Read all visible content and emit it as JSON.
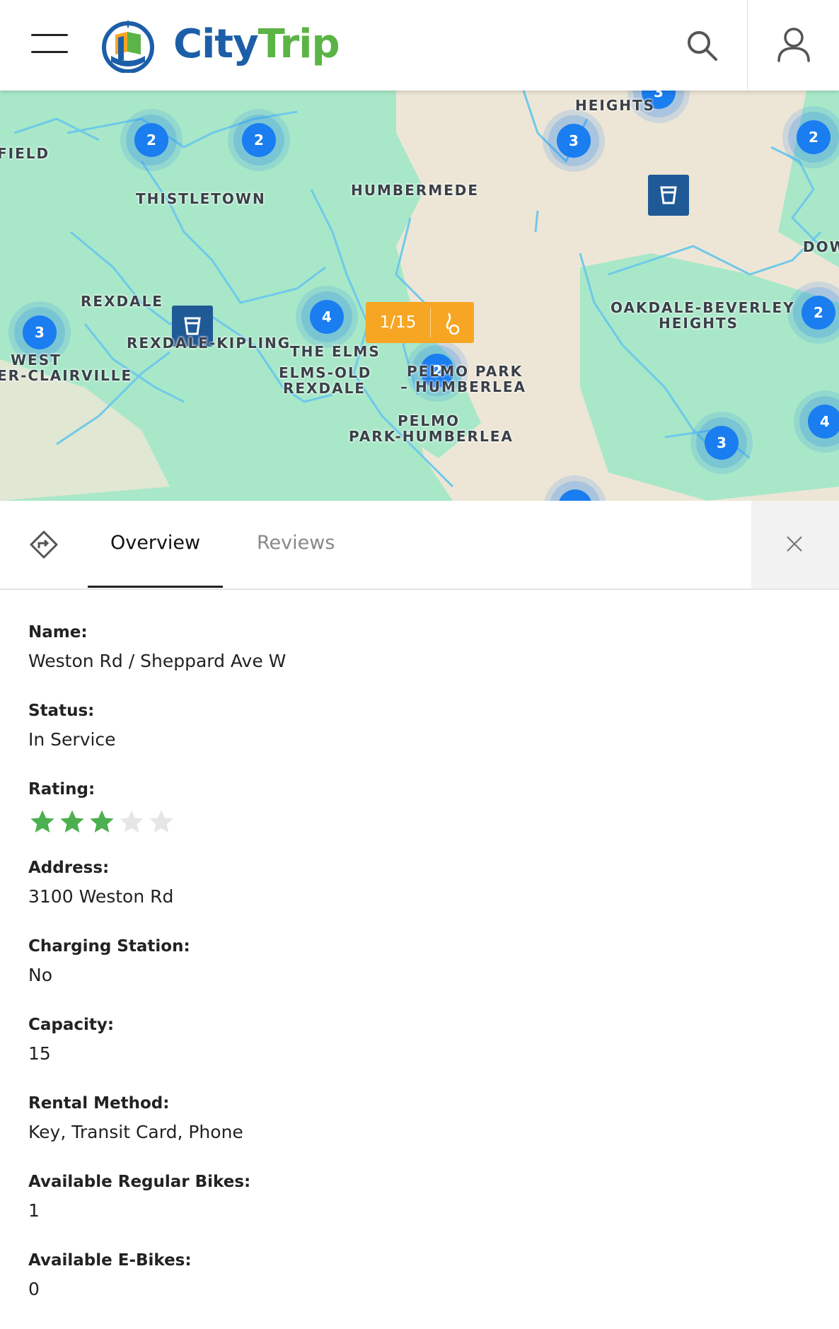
{
  "header": {
    "brand_part1": "City",
    "brand_part2": "Trip",
    "menu_icon": "hamburger-menu-icon",
    "search_icon": "search-icon",
    "user_icon": "user-icon"
  },
  "map": {
    "labels": [
      "HEIGHTS",
      "FIELD",
      "THISTLETOWN",
      "HUMBERMEDE",
      "DOW",
      "REXDALE",
      "REXDALE-KIPLING",
      "THE ELMS",
      "ELMS-OLD",
      "REXDALE",
      "WEST",
      "ER-CLAIRVILLE",
      "OAKDALE-BEVERLEY",
      "HEIGHTS",
      "PELMO PARK",
      "– HUMBERLEA",
      "PELMO",
      "PARK-HUMBERLEA"
    ],
    "clusters": [
      "2",
      "2",
      "3",
      "3",
      "2",
      "3",
      "4",
      "2",
      "2",
      "4",
      "3"
    ],
    "selected_station": {
      "count": "1/15",
      "icon": "bike-dock-icon"
    },
    "station_icon": "bike-station-icon"
  },
  "tabs": {
    "directions_icon": "directions-icon",
    "overview": "Overview",
    "reviews": "Reviews",
    "close_icon": "close-icon",
    "active": "Overview"
  },
  "details": {
    "name": {
      "label": "Name:",
      "value": "Weston Rd / Sheppard Ave W"
    },
    "status": {
      "label": "Status:",
      "value": "In Service"
    },
    "rating": {
      "label": "Rating:",
      "value": 3,
      "max": 5
    },
    "address": {
      "label": "Address:",
      "value": "3100 Weston Rd"
    },
    "charging": {
      "label": "Charging Station:",
      "value": "No"
    },
    "capacity": {
      "label": "Capacity:",
      "value": "15"
    },
    "rental": {
      "label": "Rental Method:",
      "value": "Key, Transit Card, Phone"
    },
    "regular_bikes": {
      "label": "Available Regular Bikes:",
      "value": "1"
    },
    "ebikes": {
      "label": "Available E-Bikes:",
      "value": "0"
    }
  },
  "colors": {
    "brand_blue": "#1c5fa8",
    "brand_green": "#5bb445",
    "cluster_blue": "#1a7df0",
    "selected_orange": "#f6a623",
    "star_filled": "#4caf50",
    "star_empty": "#e6e6e6"
  }
}
